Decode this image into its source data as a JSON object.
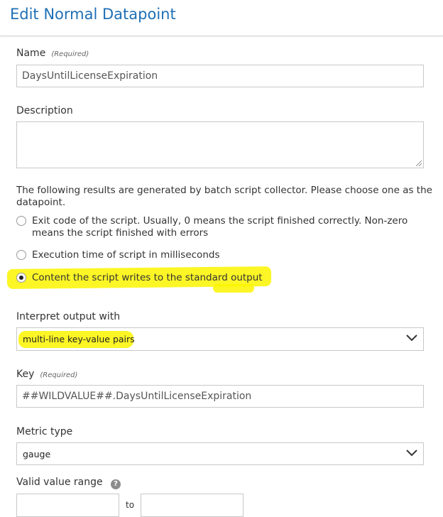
{
  "dialog": {
    "title": "Edit Normal Datapoint"
  },
  "name": {
    "label": "Name",
    "required": "(Required)",
    "value": "DaysUntilLicenseExpiration"
  },
  "description": {
    "label": "Description",
    "value": ""
  },
  "results": {
    "intro": "The following results are generated by batch script collector. Please choose one as the datapoint.",
    "options": [
      {
        "label": "Exit code of the script. Usually, 0 means the script finished correctly. Non-zero means the script finished with errors",
        "checked": false
      },
      {
        "label": "Execution time of script in milliseconds",
        "checked": false
      },
      {
        "label": "Content the script writes to the standard output",
        "checked": true
      }
    ]
  },
  "interpret": {
    "label": "Interpret output with",
    "selected": "multi-line key-value pairs"
  },
  "key": {
    "label": "Key",
    "required": "(Required)",
    "value": "##WILDVALUE##.DaysUntilLicenseExpiration"
  },
  "metric_type": {
    "label": "Metric type",
    "selected": "gauge"
  },
  "valid_range": {
    "label": "Valid value range",
    "help_icon": "?",
    "to_label": "to",
    "min": "",
    "max": ""
  },
  "colors": {
    "title": "#1f6fb5",
    "highlight": "#fbf400"
  }
}
